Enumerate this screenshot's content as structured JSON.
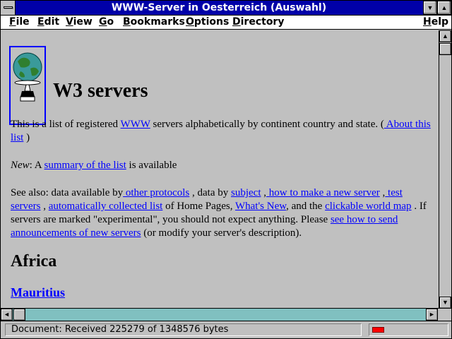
{
  "window": {
    "title": "WWW-Server in Oesterreich (Auswahl)"
  },
  "titlebar_buttons": {
    "minimize_icon": "▼",
    "maximize_icon": "▲"
  },
  "menubar": {
    "items": [
      {
        "label": "File",
        "underline": "F",
        "rest": "ile"
      },
      {
        "label": "Edit",
        "underline": "E",
        "rest": "dit"
      },
      {
        "label": "View",
        "underline": "V",
        "rest": "iew"
      },
      {
        "label": "Go",
        "underline": "G",
        "rest": "o"
      },
      {
        "label": "Bookmarks",
        "underline": "B",
        "rest": "ookmarks"
      },
      {
        "label": "Options",
        "underline": "O",
        "rest": "ptions"
      },
      {
        "label": "Directory",
        "underline": "D",
        "rest": "irectory"
      },
      {
        "label": "Help",
        "underline": "H",
        "rest": "elp"
      }
    ]
  },
  "page": {
    "heading": "W3 servers",
    "intro": {
      "t1": "This is a list of registered ",
      "link_www": "WWW",
      "t2": " servers alphabetically by continent country and state. (",
      "link_about": " About this list",
      "t3": " )"
    },
    "new_line": {
      "label": "New",
      "t1": ": A ",
      "link_summary": "summary of the list",
      "t2": " is available"
    },
    "see_also": {
      "t1": "See also: data available by",
      "link_protocols": " other protocols",
      "t2": " , data by ",
      "link_subject": "subject",
      "t3": " ,",
      "link_make": " how to make a new server",
      "t4": " ,",
      "link_test": " test servers",
      "t5": " , ",
      "link_auto": "automatically collected list",
      "t6": " of Home Pages, ",
      "link_whatsnew": "What's New",
      "t7": ", and the ",
      "link_worldmap": "clickable world map",
      "t8": " . If servers are marked \"experimental\", you should not expect anything. Please ",
      "link_announce": "see how to send announcements of new servers",
      "t9": " (or modify your server's description)."
    },
    "section_heading": "Africa",
    "country_link": "Mauritius"
  },
  "scrollbars": {
    "up_icon": "▲",
    "down_icon": "▼",
    "left_icon": "◄",
    "right_icon": "►"
  },
  "status": {
    "text": "Document: Received 225279 of 1348576 bytes",
    "progress_fraction": 0.167,
    "progress_color": "#ff0000"
  },
  "colors": {
    "titlebar": "#0000a8",
    "link": "#0000ff",
    "background": "#c0c0c0",
    "hscroll_track": "#80c0c0"
  }
}
